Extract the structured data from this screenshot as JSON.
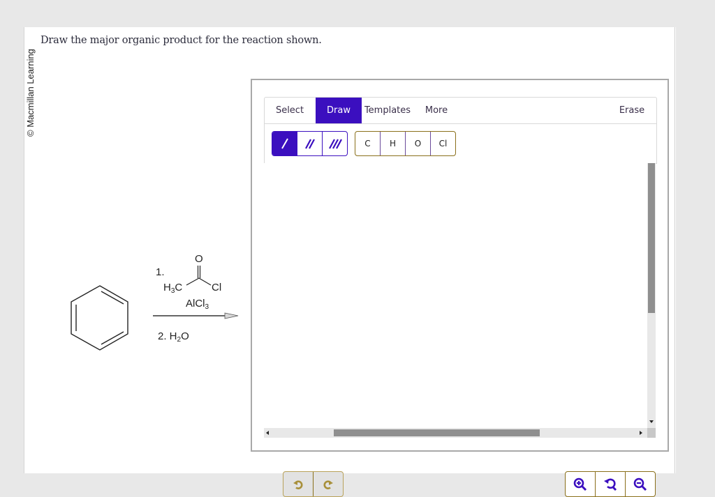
{
  "copyright": "© Macmillan Learning",
  "question": "Draw the major organic product for the reaction shown.",
  "reaction": {
    "starting_material": "benzene",
    "step1_label": "1.",
    "reagent1": {
      "left_group": "H3C",
      "left_group_main": "H",
      "left_group_sub": "3",
      "left_group_tail": "C",
      "carbonyl_oxygen": "O",
      "right_group": "Cl"
    },
    "catalyst": {
      "main": "AlCl",
      "sub": "3"
    },
    "step2": {
      "prefix": "2. H",
      "sub": "2",
      "suffix": "O"
    }
  },
  "editor": {
    "tabs": [
      {
        "label": "Select",
        "active": false
      },
      {
        "label": "Draw",
        "active": true
      },
      {
        "label": "Templates",
        "active": false
      },
      {
        "label": "More",
        "active": false
      }
    ],
    "erase_label": "Erase",
    "bond_tools": [
      {
        "name": "single-bond",
        "active": true
      },
      {
        "name": "double-bond",
        "active": false
      },
      {
        "name": "triple-bond",
        "active": false
      }
    ],
    "atom_tools": [
      "C",
      "H",
      "O",
      "Cl"
    ],
    "undo_icons": [
      "undo-icon",
      "redo-icon"
    ],
    "zoom_icons": [
      "zoom-in-icon",
      "reset-zoom-icon",
      "zoom-out-icon"
    ],
    "vertical_scroll_fraction": 0.0,
    "horizontal_scroll_fraction": 0.4
  },
  "colors": {
    "accent": "#3b0fbf",
    "button_border": "#8a6f1a",
    "undo_icon": "#a8903a"
  }
}
